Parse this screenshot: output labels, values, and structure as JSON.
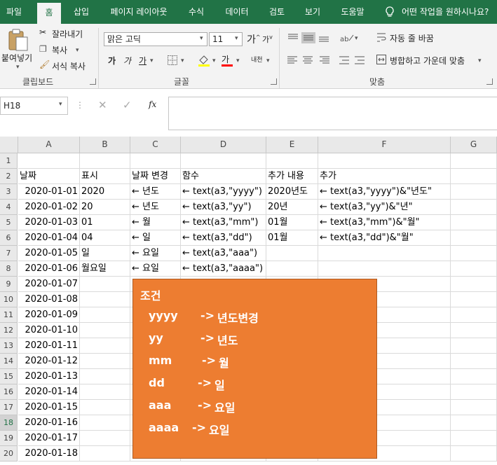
{
  "tabs": [
    "파일",
    "홈",
    "삽입",
    "페이지 레이아웃",
    "수식",
    "데이터",
    "검토",
    "보기",
    "도움말"
  ],
  "tell_me": "어떤 작업을 원하시나요?",
  "clipboard": {
    "paste": "붙여넣기",
    "cut": "잘라내기",
    "copy": "복사",
    "format_painter": "서식 복사",
    "group": "클립보드"
  },
  "font": {
    "name": "맑은 고딕",
    "size": "11",
    "bold": "가",
    "italic": "가",
    "underline": "가",
    "font_color_glyph": "가",
    "phonetic": "내천",
    "group": "글꼴"
  },
  "alignment": {
    "wrap_text": "자동 줄 바꿈",
    "merge_center": "병합하고 가운데 맞춤",
    "group": "맞춤"
  },
  "formula_bar": {
    "name_box": "H18",
    "fx": "fx",
    "content": ""
  },
  "columns": [
    "A",
    "B",
    "C",
    "D",
    "E",
    "F",
    "G"
  ],
  "rows": [
    "1",
    "2",
    "3",
    "4",
    "5",
    "6",
    "7",
    "8",
    "9",
    "10",
    "11",
    "12",
    "13",
    "14",
    "15",
    "16",
    "17",
    "18",
    "19",
    "20"
  ],
  "selected_row": "18",
  "header_row": [
    "날짜",
    "표시",
    "날짜 변경",
    "함수",
    "추가 내용",
    "추가"
  ],
  "data_rows": [
    [
      "2020-01-01",
      "2020",
      "← 년도",
      "← text(a3,\"yyyy\")",
      "2020년도",
      "← text(a3,\"yyyy\")&\"년도\""
    ],
    [
      "2020-01-02",
      "20",
      "← 년도",
      "← text(a3,\"yy\")",
      "20년",
      "← text(a3,\"yy\")&\"년\""
    ],
    [
      "2020-01-03",
      "01",
      "← 월",
      "← text(a3,\"mm\")",
      "01월",
      "← text(a3,\"mm\")&\"월\""
    ],
    [
      "2020-01-04",
      "04",
      "← 일",
      "← text(a3,\"dd\")",
      "01월",
      "← text(a3,\"dd\")&\"월\""
    ],
    [
      "2020-01-05",
      "일",
      "← 요일",
      "← text(a3,\"aaa\")",
      "",
      ""
    ],
    [
      "2020-01-06",
      "월요일",
      "← 요일",
      "← text(a3,\"aaaa\")",
      "",
      ""
    ]
  ],
  "dates_more": [
    "2020-01-07",
    "2020-01-08",
    "2020-01-09",
    "2020-01-10",
    "2020-01-11",
    "2020-01-12",
    "2020-01-13",
    "2020-01-14",
    "2020-01-15",
    "2020-01-16",
    "2020-01-17",
    "2020-01-18"
  ],
  "note": {
    "title": "조건",
    "items": [
      {
        "code": "yyyy",
        "arrow": "->",
        "desc": "년도변경"
      },
      {
        "code": "yy",
        "arrow": "->",
        "desc": "년도"
      },
      {
        "code": "mm",
        "arrow": "->",
        "desc": "월"
      },
      {
        "code": "dd",
        "arrow": "->",
        "desc": "일"
      },
      {
        "code": "aaa",
        "arrow": "->",
        "desc": "요일"
      },
      {
        "code": "aaaa",
        "arrow": "->",
        "desc": "요일"
      }
    ]
  },
  "colors": {
    "ribbon_green": "#217346",
    "note_orange": "#ed7d31",
    "font_color_underline": "#ff0000"
  }
}
